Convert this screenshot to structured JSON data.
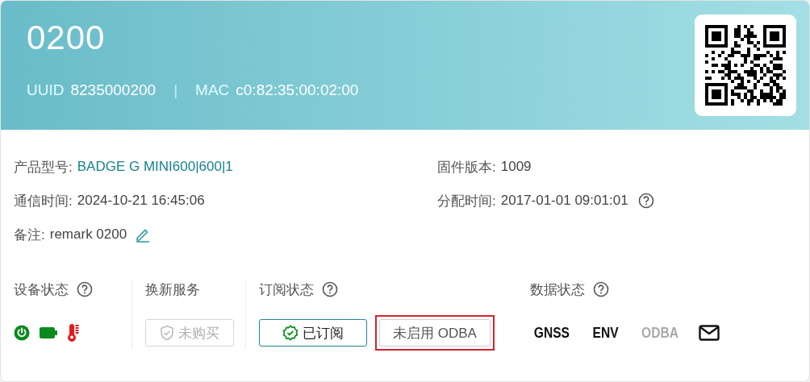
{
  "header": {
    "title": "0200",
    "uuid_label": "UUID",
    "uuid": "8235000200",
    "separator": "|",
    "mac_label": "MAC",
    "mac": "c0:82:35:00:02:00"
  },
  "info": [
    {
      "label": "产品型号:",
      "value": "BADGE G MINI600|600|1",
      "kind": "link"
    },
    {
      "label": "固件版本:",
      "value": "1009",
      "kind": "plain"
    },
    {
      "label": "通信时间:",
      "value": "2024-10-21 16:45:06",
      "kind": "plain"
    },
    {
      "label": "分配时间:",
      "value": "2017-01-01 09:01:01",
      "kind": "help"
    },
    {
      "label": "备注:",
      "value": "remark 0200",
      "kind": "edit"
    }
  ],
  "sections": [
    {
      "title": "设备状态",
      "help": true,
      "kind": "icons",
      "icons": [
        {
          "kind": "power",
          "color": "#0a8a1e"
        },
        {
          "kind": "battery",
          "color": "#0a8a1e"
        },
        {
          "kind": "thermometer",
          "color": "#e41c1c"
        }
      ]
    },
    {
      "title": "换新服务",
      "help": false,
      "kind": "buttons",
      "buttons": [
        {
          "label": "未购买",
          "kind": "shield",
          "disabled": true,
          "highlighted": false
        }
      ]
    },
    {
      "title": "订阅状态",
      "help": true,
      "kind": "buttons",
      "buttons": [
        {
          "label": "已订阅",
          "kind": "badge",
          "disabled": false,
          "highlighted": false
        },
        {
          "label": "未启用 ODBA",
          "kind": "plain",
          "disabled": false,
          "highlighted": true
        }
      ]
    },
    {
      "title": "数据状态",
      "help": true,
      "kind": "data",
      "items": [
        {
          "label": "GNSS",
          "kind": "text",
          "active": true
        },
        {
          "label": "ENV",
          "kind": "text",
          "active": true
        },
        {
          "label": "ODBA",
          "kind": "text",
          "active": false
        },
        {
          "kind": "mail",
          "active": true
        }
      ]
    }
  ]
}
